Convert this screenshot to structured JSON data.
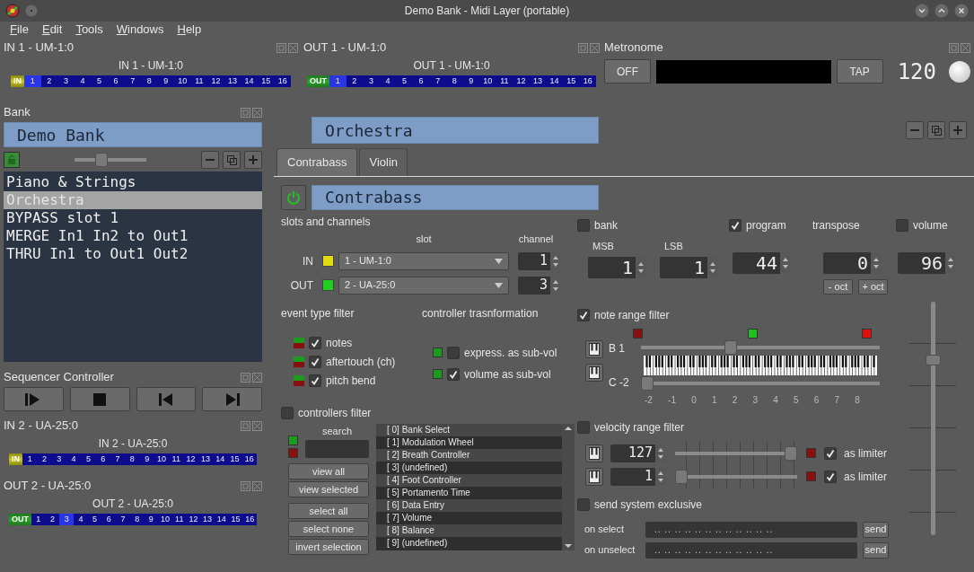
{
  "window": {
    "title": "Demo Bank - Midi Layer (portable)"
  },
  "menu": [
    "File",
    "Edit",
    "Tools",
    "Windows",
    "Help"
  ],
  "ports": [
    {
      "dock_title": "IN 1 - UM-1:0",
      "label": "IN 1 - UM-1:0",
      "kind": "in",
      "tag": "IN",
      "channels": [
        {
          "label": "1",
          "active": true
        },
        {
          "label": "2",
          "active": false
        },
        {
          "label": "3",
          "active": false
        },
        {
          "label": "4",
          "active": false
        },
        {
          "label": "5",
          "active": false
        },
        {
          "label": "6",
          "active": false
        },
        {
          "label": "7",
          "active": false
        },
        {
          "label": "8",
          "active": false
        },
        {
          "label": "9",
          "active": false
        },
        {
          "label": "10",
          "active": false
        },
        {
          "label": "11",
          "active": false
        },
        {
          "label": "12",
          "active": false
        },
        {
          "label": "13",
          "active": false
        },
        {
          "label": "14",
          "active": false
        },
        {
          "label": "15",
          "active": false
        },
        {
          "label": "16",
          "active": false
        }
      ]
    },
    {
      "dock_title": "OUT 1 - UM-1:0",
      "label": "OUT 1 - UM-1:0",
      "kind": "out",
      "tag": "OUT",
      "channels": [
        {
          "label": "1",
          "active": true
        },
        {
          "label": "2",
          "active": false
        },
        {
          "label": "3",
          "active": false
        },
        {
          "label": "4",
          "active": false
        },
        {
          "label": "5",
          "active": false
        },
        {
          "label": "6",
          "active": false
        },
        {
          "label": "7",
          "active": false
        },
        {
          "label": "8",
          "active": false
        },
        {
          "label": "9",
          "active": false
        },
        {
          "label": "10",
          "active": false
        },
        {
          "label": "11",
          "active": false
        },
        {
          "label": "12",
          "active": false
        },
        {
          "label": "13",
          "active": false
        },
        {
          "label": "14",
          "active": false
        },
        {
          "label": "15",
          "active": false
        },
        {
          "label": "16",
          "active": false
        }
      ]
    },
    {
      "dock_title": "IN 2 - UA-25:0",
      "label": "IN 2 - UA-25:0",
      "kind": "in",
      "tag": "IN",
      "channels": [
        {
          "label": "1",
          "active": false
        },
        {
          "label": "2",
          "active": false
        },
        {
          "label": "3",
          "active": false
        },
        {
          "label": "4",
          "active": false
        },
        {
          "label": "5",
          "active": false
        },
        {
          "label": "6",
          "active": false
        },
        {
          "label": "7",
          "active": false
        },
        {
          "label": "8",
          "active": false
        },
        {
          "label": "9",
          "active": false
        },
        {
          "label": "10",
          "active": false
        },
        {
          "label": "11",
          "active": false
        },
        {
          "label": "12",
          "active": false
        },
        {
          "label": "13",
          "active": false
        },
        {
          "label": "14",
          "active": false
        },
        {
          "label": "15",
          "active": false
        },
        {
          "label": "16",
          "active": false
        }
      ]
    },
    {
      "dock_title": "OUT 2 - UA-25:0",
      "label": "OUT 2 - UA-25:0",
      "kind": "out",
      "tag": "OUT",
      "channels": [
        {
          "label": "1",
          "active": false
        },
        {
          "label": "2",
          "active": false
        },
        {
          "label": "3",
          "active": true
        },
        {
          "label": "4",
          "active": false
        },
        {
          "label": "5",
          "active": false
        },
        {
          "label": "6",
          "active": false
        },
        {
          "label": "7",
          "active": false
        },
        {
          "label": "8",
          "active": false
        },
        {
          "label": "9",
          "active": false
        },
        {
          "label": "10",
          "active": false
        },
        {
          "label": "11",
          "active": false
        },
        {
          "label": "12",
          "active": false
        },
        {
          "label": "13",
          "active": false
        },
        {
          "label": "14",
          "active": false
        },
        {
          "label": "15",
          "active": false
        },
        {
          "label": "16",
          "active": false
        }
      ]
    }
  ],
  "metronome": {
    "dock_title": "Metronome",
    "toggle": "OFF",
    "tap": "TAP",
    "tempo": "120"
  },
  "bank": {
    "dock_title": "Bank",
    "name": "Demo Bank",
    "zoom": {
      "level": 0.35
    },
    "items": [
      {
        "label": "Piano & Strings",
        "selected": false
      },
      {
        "label": "Orchestra",
        "selected": true
      },
      {
        "label": "BYPASS slot 1",
        "selected": false
      },
      {
        "label": "MERGE In1 In2 to Out1",
        "selected": false
      },
      {
        "label": "THRU In1 to Out1 Out2",
        "selected": false
      }
    ]
  },
  "sequencer": {
    "dock_title": "Sequencer Controller",
    "buttons": [
      {
        "kind": "play"
      },
      {
        "kind": "stop"
      },
      {
        "kind": "prev"
      },
      {
        "kind": "next"
      }
    ]
  },
  "layer": {
    "name": "Orchestra",
    "tabs": [
      {
        "label": "Contrabass",
        "selected": true
      },
      {
        "label": "Violin",
        "selected": false
      }
    ],
    "slot": {
      "enabled": true,
      "name": "Contrabass",
      "routing": {
        "title": "slots and channels",
        "slot_heading": "slot",
        "channel_heading": "channel",
        "rows": [
          {
            "label": "IN",
            "color": "#e0dc10",
            "port": "1 - UM-1:0",
            "channel": "1"
          },
          {
            "label": "OUT",
            "color": "#20d020",
            "port": "2 - UA-25:0",
            "channel": "3"
          }
        ]
      },
      "bank": {
        "label": "bank",
        "checked": false,
        "msb_label": "MSB",
        "msb": "1",
        "lsb_label": "LSB",
        "lsb": "1"
      },
      "program": {
        "label": "program",
        "checked": true,
        "value": "44"
      },
      "transpose": {
        "label": "transpose",
        "value": "0",
        "buttons": [
          "- oct",
          "+ oct"
        ]
      },
      "volume": {
        "label": "volume",
        "checked": false,
        "value": "96",
        "level": 0.76
      },
      "event_filter": {
        "title": "event type filter",
        "items": [
          {
            "label": "notes",
            "checked": true
          },
          {
            "label": "aftertouch (ch)",
            "checked": true
          },
          {
            "label": "pitch bend",
            "checked": true
          }
        ]
      },
      "controller_transformation": {
        "title": "controller trasnformation",
        "items": [
          {
            "label": "express. as sub-vol",
            "checked": false
          },
          {
            "label": "volume as sub-vol",
            "checked": true
          }
        ]
      },
      "controllers_filter": {
        "label": "controllers filter",
        "checked": false,
        "search_label": "search",
        "buttons": [
          "view all",
          "view selected",
          "select all",
          "select none",
          "invert selection"
        ],
        "items": [
          "[ 0] Bank Select",
          "[ 1] Modulation Wheel",
          "[ 2] Breath Controller",
          "[ 3] (undefined)",
          "[ 4] Foot Controller",
          "[ 5] Portamento Time",
          "[ 6] Data Entry",
          "[ 7] Volume",
          "[ 8] Balance",
          "[ 9] (undefined)"
        ]
      },
      "note_range": {
        "label": "note range filter",
        "checked": true,
        "high": {
          "note": "B 1",
          "level": 0.37
        },
        "low": {
          "note": "C -2",
          "level": 0
        },
        "octaves": [
          "-2",
          "-1",
          "0",
          "1",
          "2",
          "3",
          "4",
          "5",
          "6",
          "7",
          "8"
        ]
      },
      "velocity_range": {
        "label": "velocity range filter",
        "checked": false,
        "rows": [
          {
            "value": "127",
            "level": 1,
            "limiter_label": "as limiter",
            "limiter": true
          },
          {
            "value": "1",
            "level": 0,
            "limiter_label": "as limiter",
            "limiter": true
          }
        ]
      },
      "sysex": {
        "label": "send system exclusive",
        "checked": false,
        "rows": [
          {
            "label": "on select",
            "value": ".. .. .. .. .. .. .. .. .. .. .. ..",
            "button": "send"
          },
          {
            "label": "on unselect",
            "value": ".. .. .. .. .. .. .. .. .. .. .. ..",
            "button": "send"
          }
        ]
      }
    }
  }
}
